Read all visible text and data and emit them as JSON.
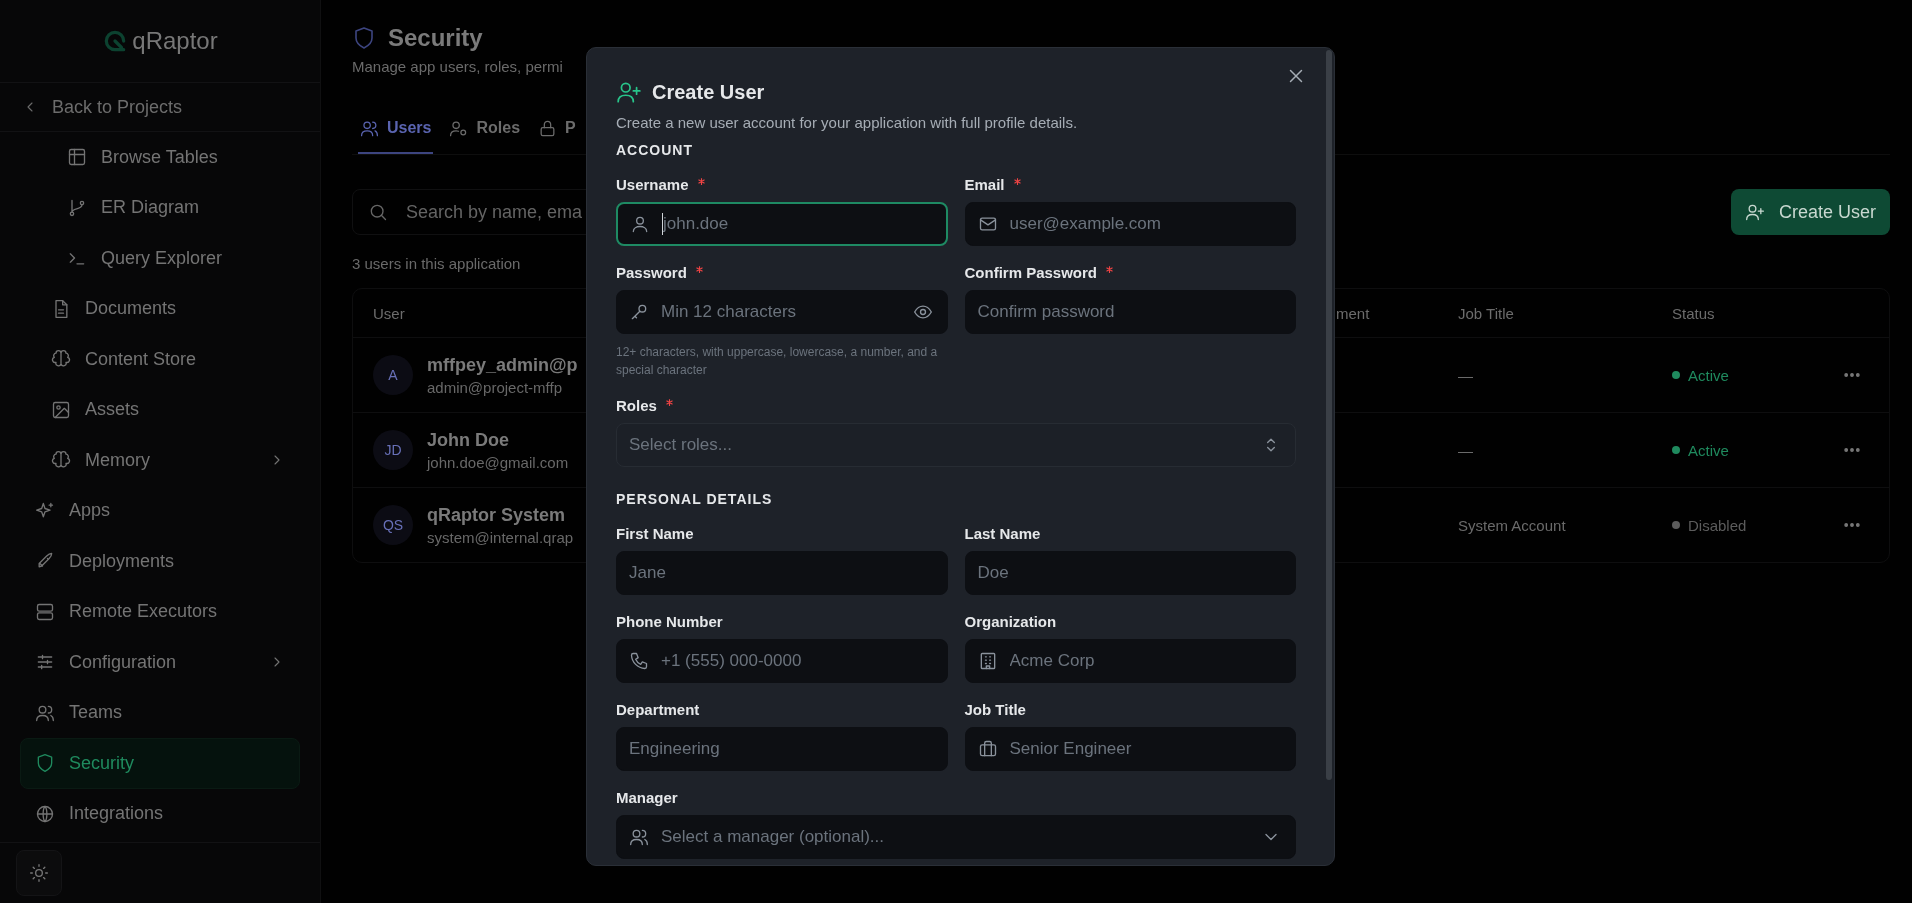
{
  "sidebar": {
    "logo": "qRaptor",
    "back_link": "Back to Projects",
    "items": [
      {
        "children": [
          {
            "children": [
              {
                "label": "Browse Tables",
                "selected": false,
                "expandable": false
              },
              {
                "label": "ER Diagram",
                "selected": false,
                "expandable": false
              },
              {
                "label": "Query Explorer",
                "selected": false,
                "expandable": false
              }
            ]
          },
          {
            "label": "Documents",
            "selected": false,
            "expandable": false
          },
          {
            "label": "Content Store",
            "selected": false,
            "expandable": false
          },
          {
            "label": "Assets",
            "selected": false,
            "expandable": false
          },
          {
            "label": "Memory",
            "selected": false,
            "expandable": true
          }
        ]
      },
      {
        "label": "Apps",
        "selected": false,
        "expandable": false
      },
      {
        "label": "Deployments",
        "selected": false,
        "expandable": false
      },
      {
        "label": "Remote Executors",
        "selected": false,
        "expandable": false
      },
      {
        "label": "Configuration",
        "selected": false,
        "expandable": true
      },
      {
        "label": "Teams",
        "selected": false,
        "expandable": false
      },
      {
        "label": "Security",
        "selected": true,
        "expandable": false
      },
      {
        "label": "Integrations",
        "selected": false,
        "expandable": false
      }
    ]
  },
  "header": {
    "title": "Security",
    "subtitle": "Manage app users, roles, permi"
  },
  "tabs": [
    {
      "label": "Users",
      "selected": true
    },
    {
      "label": "Roles",
      "selected": false
    },
    {
      "label": "P",
      "selected": false
    }
  ],
  "search": {
    "placeholder": "Search by name, ema"
  },
  "create_button": "Create User",
  "user_count": "3 users in this application",
  "table": {
    "columns": [
      "User",
      "ment",
      "Job Title",
      "Status"
    ],
    "rows": [
      {
        "initials": "A",
        "name": "mffpey_admin@p",
        "email": "admin@project-mffp",
        "job_title": "—",
        "status": "Active",
        "color": "#1f8a5e"
      },
      {
        "initials": "JD",
        "name": "John Doe",
        "email": "john.doe@gmail.com",
        "job_title": "—",
        "status": "Active",
        "color": "#1f8a5e"
      },
      {
        "initials": "QS",
        "name": "qRaptor System",
        "email": "system@internal.qrap",
        "job_title": "System Account",
        "status": "Disabled",
        "color": "#5c5c5c"
      }
    ]
  },
  "modal": {
    "title": "Create User",
    "description": "Create a new user account for your application with full profile details.",
    "sections": [
      {
        "heading": "ACCOUNT",
        "fields": [
          {
            "label": "Username",
            "required": true,
            "placeholder": "john.doe",
            "focused": true,
            "kind": "text"
          },
          {
            "label": "Email",
            "required": true,
            "placeholder": "user@example.com",
            "focused": false,
            "kind": "text"
          },
          {
            "label": "Password",
            "required": true,
            "placeholder": "Min 12 characters",
            "focused": false,
            "kind": "password",
            "hint": "12+ characters, with uppercase, lowercase, a number, and a special character"
          },
          {
            "label": "Confirm Password",
            "required": true,
            "placeholder": "Confirm password",
            "focused": false,
            "kind": "text"
          },
          {
            "label": "Roles",
            "required": true,
            "placeholder": "Select roles...",
            "focused": false,
            "kind": "multiselect"
          }
        ]
      },
      {
        "heading": "PERSONAL DETAILS",
        "fields": [
          {
            "label": "First Name",
            "required": false,
            "placeholder": "Jane",
            "focused": false,
            "kind": "text"
          },
          {
            "label": "Last Name",
            "required": false,
            "placeholder": "Doe",
            "focused": false,
            "kind": "text"
          },
          {
            "label": "Phone Number",
            "required": false,
            "placeholder": "+1 (555) 000-0000",
            "focused": false,
            "kind": "text"
          },
          {
            "label": "Organization",
            "required": false,
            "placeholder": "Acme Corp",
            "focused": false,
            "kind": "text"
          },
          {
            "label": "Department",
            "required": false,
            "placeholder": "Engineering",
            "focused": false,
            "kind": "text"
          },
          {
            "label": "Job Title",
            "required": false,
            "placeholder": "Senior Engineer",
            "focused": false,
            "kind": "text"
          },
          {
            "label": "Manager",
            "required": false,
            "placeholder": "Select a manager (optional)...",
            "focused": false,
            "kind": "select"
          }
        ]
      }
    ]
  }
}
